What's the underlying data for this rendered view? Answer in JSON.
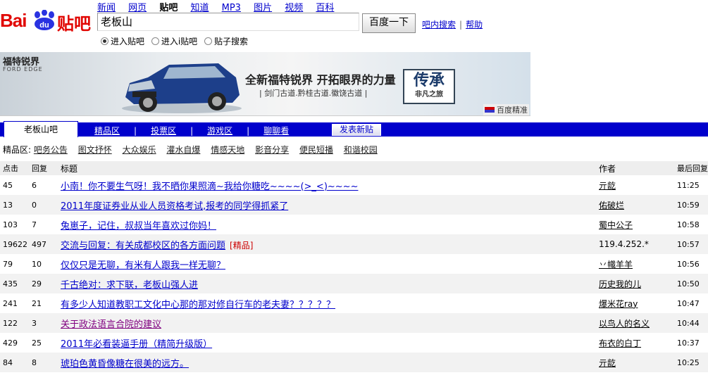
{
  "header": {
    "logo_text": "Bai du 贴吧",
    "nav": [
      "新闻",
      "网页",
      "贴吧",
      "知道",
      "MP3",
      "图片",
      "视频",
      "百科"
    ],
    "active_nav": "贴吧",
    "search_value": "老板山",
    "search_button": "百度一下",
    "links": [
      "吧内搜索",
      "帮助"
    ],
    "radios": [
      {
        "label": "进入贴吧",
        "checked": true
      },
      {
        "label": "进入i贴吧",
        "checked": false
      },
      {
        "label": "贴子搜索",
        "checked": false
      }
    ]
  },
  "banner": {
    "brand": "福特锐界",
    "brand_sub": "FORD EDGE",
    "slogan": "全新福特锐界 开拓眼界的力量",
    "subtitle": "| 剑门古道.黔桂古道.徽饶古道 |",
    "badge": "传承",
    "badge_sub": "非凡之旅",
    "ad_label": "百度精准"
  },
  "tabs": {
    "active": "老板山吧",
    "items": [
      "精品区",
      "投票区",
      "游戏区",
      "聊聊看"
    ],
    "separator": "|",
    "post_button": "发表新贴"
  },
  "subnav": {
    "label": "精品区:",
    "items": [
      "吧务公告",
      "图文抒怀",
      "大众娱乐",
      "灌水自爆",
      "情感天地",
      "影音分享",
      "便民短播",
      "和谐校园"
    ]
  },
  "table": {
    "headers": [
      "点击",
      "回复",
      "标题",
      "作者",
      "最后回复"
    ],
    "rows": [
      {
        "clicks": "45",
        "replies": "6",
        "title": "小南！你不要生气呀！我不晒你果照滴~我给你糖吃~~~~(>_<)~~~~",
        "tag": "",
        "author": "亓龁",
        "time": "11:25"
      },
      {
        "clicks": "13",
        "replies": "0",
        "title": "2011年度证券业从业人员资格考试,报考的同学得抓紧了",
        "tag": "",
        "author": "佑破烂",
        "time": "10:59"
      },
      {
        "clicks": "103",
        "replies": "7",
        "title": "兔崽子，记住，叔叔当年喜欢过你妈！",
        "tag": "",
        "author": "蜀中公子",
        "time": "10:58"
      },
      {
        "clicks": "19622",
        "replies": "497",
        "title": "交流与回复：有关成都校区的各方面问题",
        "tag": "[精品]",
        "author": "119.4.252.*",
        "time": "10:57"
      },
      {
        "clicks": "79",
        "replies": "10",
        "title": "仅仅只是无聊，有米有人跟我一样无聊？",
        "tag": "",
        "author": "丷幟羊羊",
        "time": "10:56"
      },
      {
        "clicks": "435",
        "replies": "29",
        "title": "千古绝对：求下联，老板山强人进",
        "tag": "",
        "author": "历史我的儿",
        "time": "10:50"
      },
      {
        "clicks": "241",
        "replies": "21",
        "title": "有多少人知道教职工文化中心那的那对修自行车的老夫妻？？？？？",
        "tag": "",
        "author": "爆米花ray",
        "time": "10:47"
      },
      {
        "clicks": "122",
        "replies": "3",
        "title": "关于政法语言合院的建议",
        "tag": "",
        "author": "以鸟人的名义",
        "time": "10:44",
        "visited": true
      },
      {
        "clicks": "429",
        "replies": "25",
        "title": "2011年必看装逼手册（精简升级版）",
        "tag": "",
        "author": "布衣的白丁",
        "time": "10:37"
      },
      {
        "clicks": "84",
        "replies": "8",
        "title": "琥珀色黄昏像糖在很美的远方。",
        "tag": "",
        "author": "亓龁",
        "time": "10:25"
      }
    ]
  }
}
